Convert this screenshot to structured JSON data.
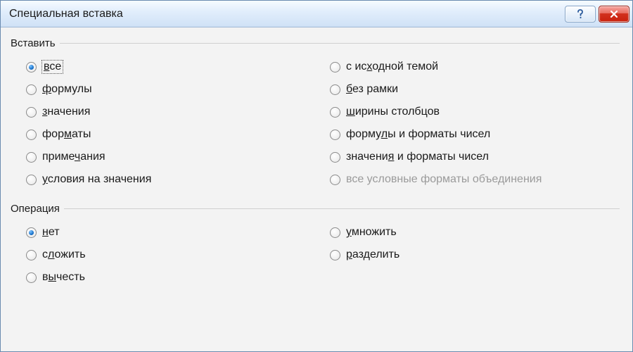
{
  "title": "Специальная вставка",
  "groups": {
    "paste": {
      "legend": "Вставить",
      "options": {
        "all": {
          "pre": "",
          "u": "в",
          "post": "се",
          "checked": true,
          "disabled": false,
          "focused": true
        },
        "formulas": {
          "pre": "",
          "u": "ф",
          "post": "ормулы",
          "checked": false,
          "disabled": false
        },
        "values": {
          "pre": "",
          "u": "з",
          "post": "начения",
          "checked": false,
          "disabled": false
        },
        "formats": {
          "pre": "фор",
          "u": "м",
          "post": "аты",
          "checked": false,
          "disabled": false
        },
        "comments": {
          "pre": "приме",
          "u": "ч",
          "post": "ания",
          "checked": false,
          "disabled": false
        },
        "validation": {
          "pre": "",
          "u": "у",
          "post": "словия на значения",
          "checked": false,
          "disabled": false
        },
        "theme": {
          "pre": "с ис",
          "u": "х",
          "post": "одной темой",
          "checked": false,
          "disabled": false
        },
        "noborder": {
          "pre": "",
          "u": "б",
          "post": "ез рамки",
          "checked": false,
          "disabled": false
        },
        "colwidths": {
          "pre": "",
          "u": "ш",
          "post": "ирины столбцов",
          "checked": false,
          "disabled": false
        },
        "formnums": {
          "pre": "форму",
          "u": "л",
          "post": "ы и форматы чисел",
          "checked": false,
          "disabled": false
        },
        "valnums": {
          "pre": "значени",
          "u": "я",
          "post": " и форматы чисел",
          "checked": false,
          "disabled": false
        },
        "mergecond": {
          "pre": "все условные форматы объединения",
          "u": "",
          "post": "",
          "checked": false,
          "disabled": true
        }
      }
    },
    "operation": {
      "legend": "Операция",
      "options": {
        "none": {
          "pre": "",
          "u": "н",
          "post": "ет",
          "checked": true,
          "disabled": false
        },
        "add": {
          "pre": "с",
          "u": "л",
          "post": "ожить",
          "checked": false,
          "disabled": false
        },
        "subtract": {
          "pre": "в",
          "u": "ы",
          "post": "честь",
          "checked": false,
          "disabled": false
        },
        "multiply": {
          "pre": "",
          "u": "у",
          "post": "множить",
          "checked": false,
          "disabled": false
        },
        "divide": {
          "pre": "",
          "u": "р",
          "post": "азделить",
          "checked": false,
          "disabled": false
        }
      }
    }
  }
}
